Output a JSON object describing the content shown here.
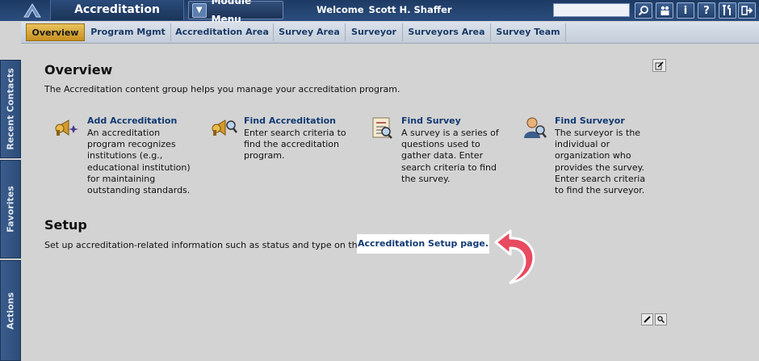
{
  "header": {
    "app_title": "Accreditation",
    "module_menu_label": "Module Menu",
    "welcome_label": "Welcome",
    "user_name": "Scott H. Shaffer",
    "search_value": "",
    "tools": [
      {
        "name": "search-icon",
        "glyph": "⚲"
      },
      {
        "name": "people-icon",
        "glyph": "👥"
      },
      {
        "name": "info-icon",
        "glyph": "i"
      },
      {
        "name": "help-icon",
        "glyph": "?"
      },
      {
        "name": "tools-icon",
        "glyph": "⚒"
      },
      {
        "name": "logout-icon",
        "glyph": "⇥"
      }
    ]
  },
  "tabs": [
    "Overview",
    "Program Mgmt",
    "Accreditation Area",
    "Survey Area",
    "Surveyor",
    "Surveyors Area",
    "Survey Team"
  ],
  "active_tab": "Overview",
  "side_panels": [
    "Recent Contacts",
    "Favorites",
    "Actions"
  ],
  "overview": {
    "title": "Overview",
    "intro": "The Accreditation content group helps you manage your accreditation program.",
    "cards": [
      {
        "icon": "horn-add-icon",
        "title": "Add Accreditation",
        "desc": "An accreditation program recognizes institutions (e.g., educational institution) for maintaining outstanding standards."
      },
      {
        "icon": "horn-search-icon",
        "title": "Find Accreditation",
        "desc": "Enter search criteria to find the accreditation program."
      },
      {
        "icon": "survey-icon",
        "title": "Find Survey",
        "desc": "A survey is a series of questions used to gather data. Enter search criteria to find the survey."
      },
      {
        "icon": "surveyor-icon",
        "title": "Find Surveyor",
        "desc": "The surveyor is the individual or organization who provides the survey. Enter search criteria to find the surveyor."
      }
    ]
  },
  "setup": {
    "title": "Setup",
    "text": "Set up accreditation-related information such as status and type on the",
    "link": "Accreditation Setup page."
  },
  "colors": {
    "header": "#1d3a63",
    "link": "#123a73",
    "active_tab": "#d9a63a",
    "arrow": "#e84a5f"
  }
}
